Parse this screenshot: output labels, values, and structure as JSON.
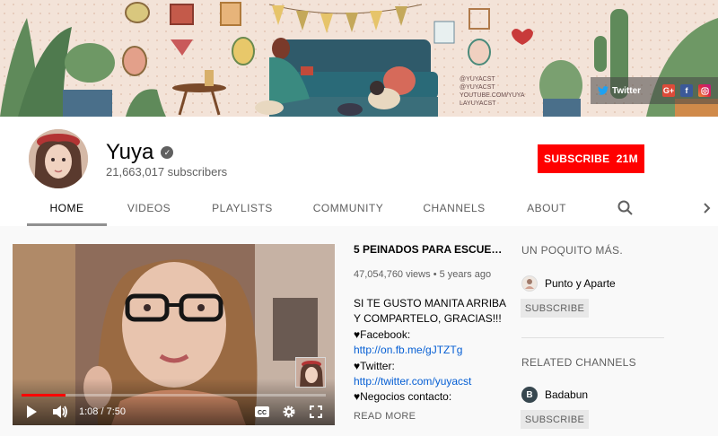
{
  "banner": {
    "social": {
      "twitter_label": "Twitter",
      "gplus_label": "G+",
      "facebook_label": "f"
    },
    "handles": [
      "@YUYACST",
      "@YUYACST",
      "YOUTUBE.COM/YUYA",
      "LAYUYACST"
    ]
  },
  "channel": {
    "name": "Yuya",
    "subscribers": "21,663,017 subscribers",
    "subscribe_label": "SUBSCRIBE",
    "subscribe_count": "21M"
  },
  "tabs": [
    "HOME",
    "VIDEOS",
    "PLAYLISTS",
    "COMMUNITY",
    "CHANNELS",
    "ABOUT"
  ],
  "video": {
    "title": "5 PEINADOS PARA ESCUELA...",
    "views": "47,054,760 views",
    "age": "5 years ago",
    "time": "1:08 / 7:50",
    "progress": 0.144,
    "description": [
      {
        "type": "text",
        "value": "SI TE GUSTO MANITA ARRIBA Y COMPARTELO, GRACIAS!!!"
      },
      {
        "type": "text",
        "value": "♥Facebook:"
      },
      {
        "type": "link",
        "value": "http://on.fb.me/gJTZTg"
      },
      {
        "type": "text",
        "value": "♥Twitter:"
      },
      {
        "type": "link",
        "value": "http://twitter.com/yuyacst"
      },
      {
        "type": "text",
        "value": "♥Negocios contacto:"
      }
    ],
    "read_more": "READ MORE"
  },
  "sidebar": {
    "section1": {
      "title": "UN POQUITO MÁS.",
      "channel": "Punto y Aparte",
      "subscribe": "SUBSCRIBE"
    },
    "section2": {
      "title": "RELATED CHANNELS",
      "channel": "Badabun",
      "avatar_letter": "B",
      "subscribe": "SUBSCRIBE"
    }
  },
  "colors": {
    "subscribe": "#ff0000",
    "link": "#065fd4",
    "progress": "#ff0000"
  }
}
